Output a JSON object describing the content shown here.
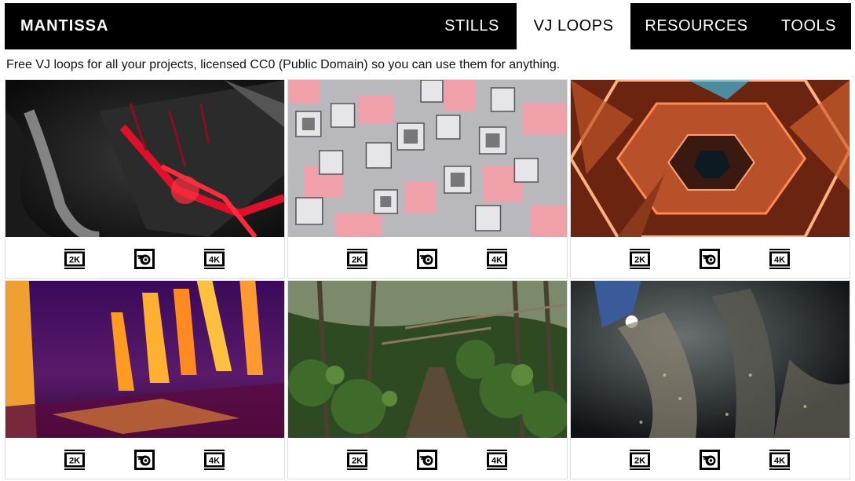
{
  "header": {
    "brand": "MANTISSA",
    "nav": [
      {
        "label": "STILLS",
        "active": false
      },
      {
        "label": "VJ LOOPS",
        "active": true
      },
      {
        "label": "RESOURCES",
        "active": false
      },
      {
        "label": "TOOLS",
        "active": false
      }
    ]
  },
  "intro": "Free VJ loops for all your projects, licensed CC0 (Public Domain) so you can use them for anything.",
  "cards": [
    {
      "theme": "dark-red-abstract",
      "badges": [
        "2K",
        "blender-icon",
        "4K"
      ]
    },
    {
      "theme": "pink-grey-cubes",
      "badges": [
        "2K",
        "blender-icon",
        "4K"
      ]
    },
    {
      "theme": "orange-neon-tunnel",
      "badges": [
        "2K",
        "blender-icon",
        "4K"
      ]
    },
    {
      "theme": "purple-yellow-forest",
      "badges": [
        "2K",
        "blender-icon",
        "4K"
      ]
    },
    {
      "theme": "green-forest-path",
      "badges": [
        "2K",
        "blender-icon",
        "4K"
      ]
    },
    {
      "theme": "dark-particle-cave",
      "badges": [
        "2K",
        "blender-icon",
        "4K"
      ]
    }
  ],
  "badge_labels": {
    "hd": "2K",
    "uhd": "4K"
  }
}
